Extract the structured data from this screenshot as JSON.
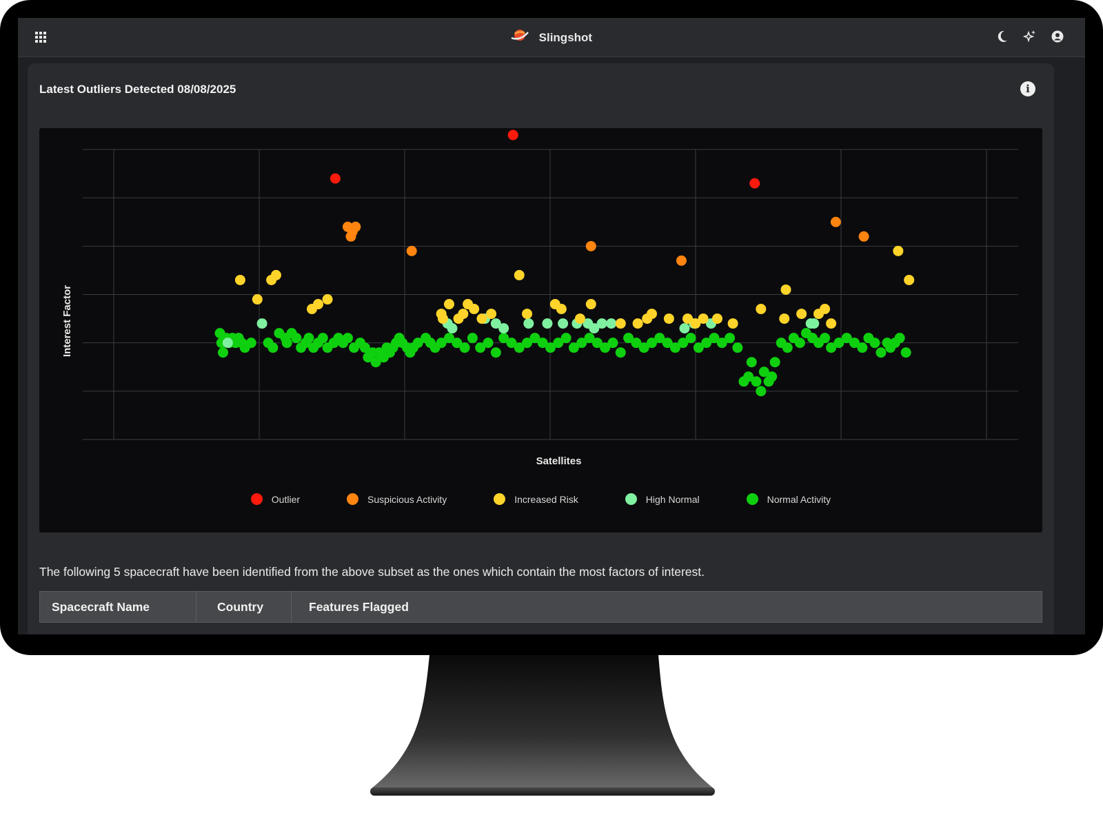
{
  "app": {
    "title": "Slingshot"
  },
  "header": {
    "icons": [
      "apps-grid-icon",
      "moon-icon",
      "sparkle-icon",
      "account-icon"
    ]
  },
  "card": {
    "title": "Latest Outliers Detected 08/08/2025",
    "info_icon": "info-icon",
    "info_glyph": "i"
  },
  "chart_data": {
    "type": "scatter",
    "xlabel": "Satellites",
    "ylabel": "Interest Factor",
    "tick_labels": "none",
    "grid": true,
    "legend_placement": "bottom-center",
    "series": [
      {
        "name": "Outlier",
        "color": "#ff1a0e",
        "points": [
          [
            162,
            6.4
          ],
          [
            276,
            7.3
          ],
          [
            431,
            6.3
          ]
        ]
      },
      {
        "name": "Suspicious Activity",
        "color": "#ff8410",
        "points": [
          [
            170,
            5.4
          ],
          [
            172,
            5.2
          ],
          [
            173,
            5.3
          ],
          [
            175,
            5.4
          ],
          [
            211,
            4.9
          ],
          [
            326,
            5.0
          ],
          [
            384,
            4.7
          ],
          [
            483,
            5.5
          ],
          [
            501,
            5.2
          ]
        ]
      },
      {
        "name": "Increased Risk",
        "color": "#ffd42a",
        "points": [
          [
            101,
            4.3
          ],
          [
            112,
            3.9
          ],
          [
            121,
            4.3
          ],
          [
            124,
            4.4
          ],
          [
            147,
            3.7
          ],
          [
            151,
            3.8
          ],
          [
            157,
            3.9
          ],
          [
            230,
            3.6
          ],
          [
            231,
            3.5
          ],
          [
            235,
            3.8
          ],
          [
            241,
            3.5
          ],
          [
            244,
            3.6
          ],
          [
            247,
            3.8
          ],
          [
            251,
            3.7
          ],
          [
            256,
            3.5
          ],
          [
            262,
            3.6
          ],
          [
            280,
            4.4
          ],
          [
            285,
            3.6
          ],
          [
            303,
            3.8
          ],
          [
            307,
            3.7
          ],
          [
            319,
            3.5
          ],
          [
            326,
            3.8
          ],
          [
            345,
            3.4
          ],
          [
            356,
            3.4
          ],
          [
            362,
            3.5
          ],
          [
            365,
            3.6
          ],
          [
            376,
            3.5
          ],
          [
            388,
            3.5
          ],
          [
            393,
            3.4
          ],
          [
            398,
            3.5
          ],
          [
            407,
            3.5
          ],
          [
            417,
            3.4
          ],
          [
            435,
            3.7
          ],
          [
            450,
            3.5
          ],
          [
            451,
            4.1
          ],
          [
            461,
            3.6
          ],
          [
            472,
            3.6
          ],
          [
            476,
            3.7
          ],
          [
            480,
            3.4
          ],
          [
            523,
            4.9
          ],
          [
            530,
            4.3
          ]
        ]
      },
      {
        "name": "High Normal",
        "color": "#7ff0a0",
        "points": [
          [
            93,
            3.0
          ],
          [
            115,
            3.4
          ],
          [
            234,
            3.4
          ],
          [
            237,
            3.3
          ],
          [
            258,
            3.5
          ],
          [
            265,
            3.4
          ],
          [
            270,
            3.3
          ],
          [
            286,
            3.4
          ],
          [
            298,
            3.4
          ],
          [
            308,
            3.4
          ],
          [
            317,
            3.4
          ],
          [
            324,
            3.4
          ],
          [
            328,
            3.3
          ],
          [
            333,
            3.4
          ],
          [
            339,
            3.4
          ],
          [
            386,
            3.3
          ],
          [
            392,
            3.4
          ],
          [
            403,
            3.4
          ],
          [
            467,
            3.4
          ],
          [
            469,
            3.4
          ]
        ]
      },
      {
        "name": "Normal Activity",
        "color": "#0fd00f",
        "points": [
          [
            88,
            3.2
          ],
          [
            89,
            3.0
          ],
          [
            90,
            2.8
          ],
          [
            92,
            3.1
          ],
          [
            94,
            3.0
          ],
          [
            96,
            3.1
          ],
          [
            98,
            3.0
          ],
          [
            100,
            3.1
          ],
          [
            102,
            3.0
          ],
          [
            104,
            2.9
          ],
          [
            108,
            3.0
          ],
          [
            119,
            3.0
          ],
          [
            122,
            2.9
          ],
          [
            126,
            3.2
          ],
          [
            130,
            3.1
          ],
          [
            131,
            3.0
          ],
          [
            134,
            3.2
          ],
          [
            137,
            3.1
          ],
          [
            140,
            2.9
          ],
          [
            143,
            3.0
          ],
          [
            145,
            3.1
          ],
          [
            148,
            2.9
          ],
          [
            151,
            3.0
          ],
          [
            154,
            3.1
          ],
          [
            157,
            2.9
          ],
          [
            161,
            3.0
          ],
          [
            164,
            3.1
          ],
          [
            167,
            3.0
          ],
          [
            170,
            3.1
          ],
          [
            174,
            2.9
          ],
          [
            178,
            3.0
          ],
          [
            181,
            2.9
          ],
          [
            183,
            2.7
          ],
          [
            186,
            2.8
          ],
          [
            188,
            2.6
          ],
          [
            190,
            2.8
          ],
          [
            193,
            2.7
          ],
          [
            195,
            2.9
          ],
          [
            197,
            2.8
          ],
          [
            199,
            2.9
          ],
          [
            201,
            3.0
          ],
          [
            203,
            3.1
          ],
          [
            205,
            3.0
          ],
          [
            208,
            2.9
          ],
          [
            210,
            2.8
          ],
          [
            212,
            2.9
          ],
          [
            215,
            3.0
          ],
          [
            220,
            3.1
          ],
          [
            223,
            3.0
          ],
          [
            226,
            2.9
          ],
          [
            230,
            3.0
          ],
          [
            235,
            3.1
          ],
          [
            240,
            3.0
          ],
          [
            245,
            2.9
          ],
          [
            250,
            3.1
          ],
          [
            255,
            2.9
          ],
          [
            260,
            3.0
          ],
          [
            265,
            2.8
          ],
          [
            270,
            3.1
          ],
          [
            275,
            3.0
          ],
          [
            280,
            2.9
          ],
          [
            285,
            3.0
          ],
          [
            290,
            3.1
          ],
          [
            295,
            3.0
          ],
          [
            300,
            2.9
          ],
          [
            305,
            3.0
          ],
          [
            310,
            3.1
          ],
          [
            315,
            2.9
          ],
          [
            320,
            3.0
          ],
          [
            325,
            3.1
          ],
          [
            330,
            3.0
          ],
          [
            335,
            2.9
          ],
          [
            340,
            3.0
          ],
          [
            345,
            2.8
          ],
          [
            350,
            3.1
          ],
          [
            355,
            3.0
          ],
          [
            360,
            2.9
          ],
          [
            365,
            3.0
          ],
          [
            370,
            3.1
          ],
          [
            375,
            3.0
          ],
          [
            380,
            2.9
          ],
          [
            385,
            3.0
          ],
          [
            390,
            3.1
          ],
          [
            395,
            2.9
          ],
          [
            400,
            3.0
          ],
          [
            405,
            3.1
          ],
          [
            410,
            3.0
          ],
          [
            415,
            3.1
          ],
          [
            420,
            2.9
          ],
          [
            424,
            2.2
          ],
          [
            427,
            2.3
          ],
          [
            429,
            2.6
          ],
          [
            432,
            2.2
          ],
          [
            435,
            2.0
          ],
          [
            437,
            2.4
          ],
          [
            440,
            2.2
          ],
          [
            442,
            2.3
          ],
          [
            444,
            2.6
          ],
          [
            448,
            3.0
          ],
          [
            452,
            2.9
          ],
          [
            456,
            3.1
          ],
          [
            460,
            3.0
          ],
          [
            464,
            3.2
          ],
          [
            468,
            3.1
          ],
          [
            472,
            3.0
          ],
          [
            476,
            3.1
          ],
          [
            480,
            2.9
          ],
          [
            485,
            3.0
          ],
          [
            490,
            3.1
          ],
          [
            495,
            3.0
          ],
          [
            500,
            2.9
          ],
          [
            504,
            3.1
          ],
          [
            508,
            3.0
          ],
          [
            512,
            2.8
          ],
          [
            516,
            3.0
          ],
          [
            518,
            2.9
          ],
          [
            521,
            3.0
          ],
          [
            524,
            3.1
          ],
          [
            528,
            2.8
          ]
        ]
      }
    ]
  },
  "description": "The following 5 spacecraft have been identified from the above subset as the ones which contain the most factors of interest.",
  "table": {
    "columns": [
      "Spacecraft Name",
      "Country",
      "Features Flagged"
    ]
  }
}
